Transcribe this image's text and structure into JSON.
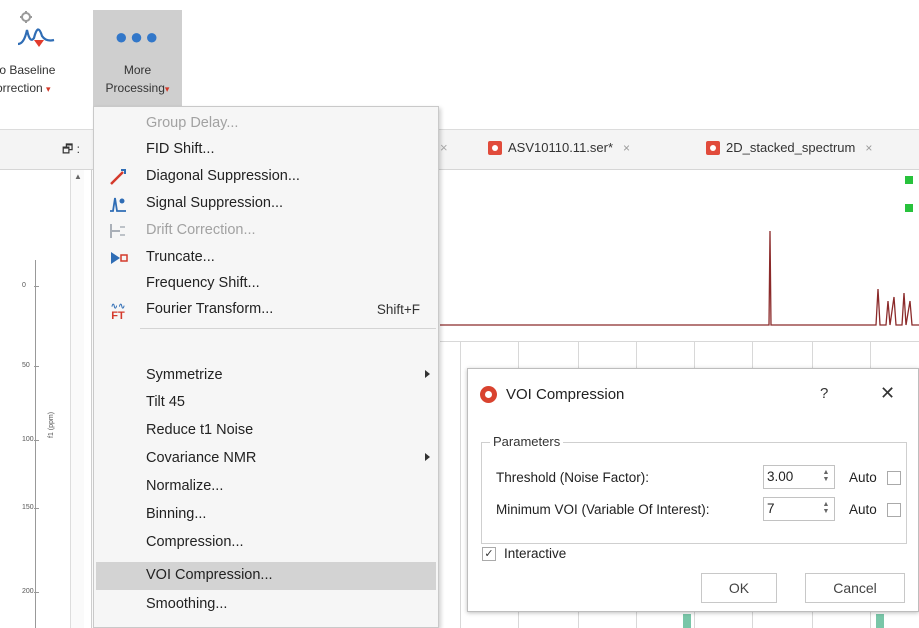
{
  "ribbon": {
    "baseline_button": {
      "label_line1": "to Baseline",
      "label_line2": "orrection",
      "caret": "▾"
    },
    "more_button": {
      "label_line1": "More",
      "label_line2": "Processing",
      "caret": "▾"
    }
  },
  "tabs": {
    "pin_label": "🗗 :",
    "items": [
      {
        "label": "ASV10110.11.ser*",
        "close": "×"
      },
      {
        "label": "2D_stacked_spectrum",
        "close": "×"
      }
    ],
    "stray_close": "×"
  },
  "axis": {
    "ticks": [
      "0",
      "50",
      "100",
      "150",
      "200"
    ],
    "label": "f1 (ppm)"
  },
  "menu": {
    "items": [
      {
        "label": "Group Delay...",
        "disabled": true
      },
      {
        "label": "FID Shift...",
        "disabled": false
      },
      {
        "label": "Diagonal Suppression...",
        "disabled": false,
        "icon": "diagonal-suppression-icon"
      },
      {
        "label": "Signal Suppression...",
        "disabled": false,
        "icon": "signal-suppression-icon"
      },
      {
        "label": "Drift Correction...",
        "disabled": true,
        "icon": "drift-correction-icon"
      },
      {
        "label": "Truncate...",
        "disabled": false,
        "icon": "truncate-icon"
      },
      {
        "label": "Frequency Shift...",
        "disabled": false
      },
      {
        "label": "Fourier Transform...",
        "disabled": false,
        "icon": "fourier-transform-icon",
        "shortcut": "Shift+F"
      },
      {
        "label": "Symmetrize",
        "disabled": false,
        "submenu": true
      },
      {
        "label": "Tilt 45",
        "disabled": false
      },
      {
        "label": "Reduce t1 Noise",
        "disabled": false
      },
      {
        "label": "Covariance NMR",
        "disabled": false,
        "submenu": true
      },
      {
        "label": "Normalize...",
        "disabled": false
      },
      {
        "label": "Binning...",
        "disabled": false
      },
      {
        "label": "Compression...",
        "disabled": false
      },
      {
        "label": "VOI Compression...",
        "disabled": false,
        "highlighted": true
      },
      {
        "label": "Smoothing...",
        "disabled": false
      }
    ],
    "fourier_icon_text": "FT"
  },
  "dialog": {
    "title": "VOI Compression",
    "help": "?",
    "close": "✕",
    "group_title": "Parameters",
    "threshold_label": "Threshold (Noise Factor):",
    "threshold_value": "3.00",
    "min_voi_label": "Minimum VOI (Variable Of Interest):",
    "min_voi_value": "7",
    "auto_label": "Auto",
    "interactive_label": "Interactive",
    "interactive_checked": "✓",
    "ok_label": "OK",
    "cancel_label": "Cancel"
  },
  "colors": {
    "spectrum_line": "#8b2a2a",
    "menu_highlight": "#d3d3d3",
    "accent_red": "#d9432f",
    "marker_green": "#28c23c"
  }
}
